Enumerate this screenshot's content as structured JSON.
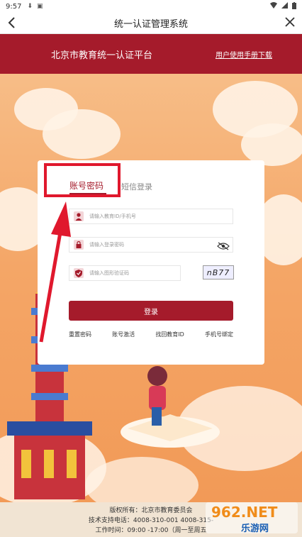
{
  "status_bar": {
    "time": "9:57"
  },
  "app_bar": {
    "title": "统一认证管理系统"
  },
  "header": {
    "portal_title": "北京市教育统一认证平台",
    "manual_link": "用户使用手册下载"
  },
  "login": {
    "tab_account": "账号密码",
    "tab_sms": "短信登录",
    "username_placeholder": "请输入教育ID/手机号",
    "password_placeholder": "请输入登录密码",
    "captcha_placeholder": "请输入图形验证码",
    "captcha_text": "nB77",
    "login_button": "登录",
    "links": [
      "重置密码",
      "账号激活",
      "找回教育ID",
      "手机号绑定"
    ]
  },
  "footer": {
    "line1": "版权所有：北京市教育委员会",
    "line2": "技术支持电话：4008-310-001 4008-315-",
    "line3": "工作时间：09:00 -17:00（周一至周五"
  },
  "watermark": {
    "brand": "962.NET",
    "sub": "乐游网"
  },
  "colors": {
    "brand_red": "#a51b2b",
    "highlight_red": "#e0182d"
  }
}
